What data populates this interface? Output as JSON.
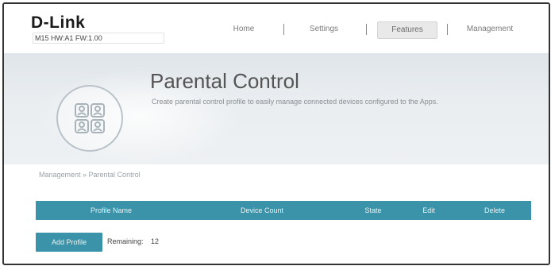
{
  "header": {
    "brand": "D-Link",
    "model_info": "M15 HW:A1 FW:1.00",
    "nav": [
      {
        "label": "Home"
      },
      {
        "label": "Settings"
      },
      {
        "label": "Features",
        "active": true
      },
      {
        "label": "Management"
      }
    ]
  },
  "banner": {
    "icon": "family-icon",
    "title": "Parental Control",
    "description": "Create parental control profile to easily manage connected devices configured to the Apps."
  },
  "breadcrumb": "Management » Parental Control",
  "table": {
    "columns": [
      "Profile Name",
      "Device Count",
      "State",
      "Edit",
      "Delete"
    ],
    "rows": []
  },
  "footer": {
    "add_label": "Add Profile",
    "remaining_label": "Remaining:",
    "remaining_value": "12"
  },
  "colors": {
    "accent": "#3a93a8",
    "banner_bg": "#e9edf0"
  }
}
